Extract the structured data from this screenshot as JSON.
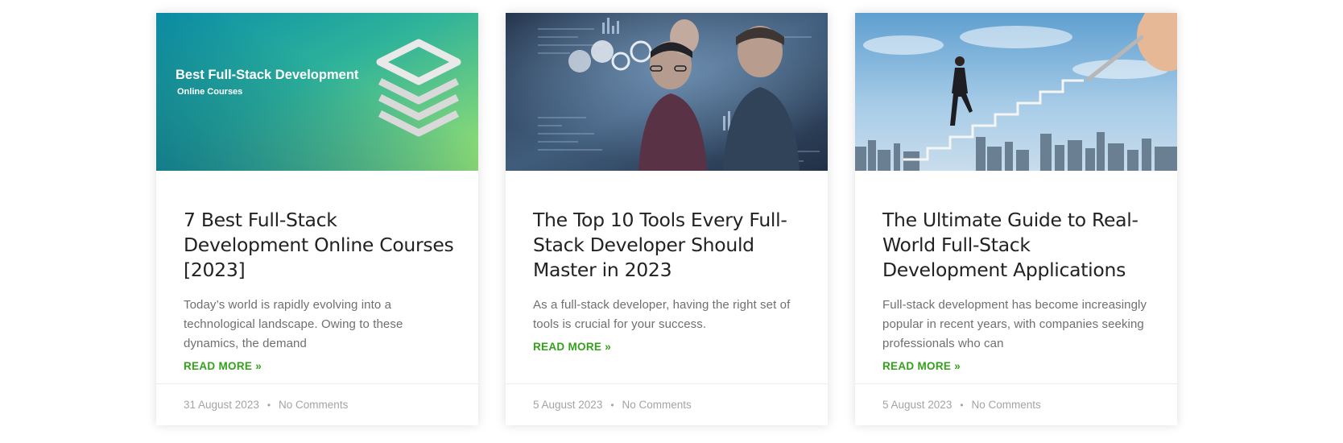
{
  "posts": [
    {
      "image_banner": {
        "heading": "Best Full-Stack Development",
        "subheading": "Online Courses"
      },
      "title": "7 Best Full-Stack Development Online Courses [2023]",
      "excerpt": "Today’s world is rapidly evolving into a technological landscape. Owing to these dynamics, the demand",
      "read_more": "READ MORE »",
      "date": "31 August 2023",
      "separator": "•",
      "comments": "No Comments"
    },
    {
      "title": "The Top 10 Tools Every Full-Stack Developer Should Master in 2023",
      "excerpt": "As a full-stack developer, having the right set of tools is crucial for your success.",
      "read_more": "READ MORE »",
      "date": "5 August 2023",
      "separator": "•",
      "comments": "No Comments"
    },
    {
      "title": "The Ultimate Guide to Real-World Full-Stack Development Applications",
      "excerpt": "Full-stack development has become increasingly popular in recent years, with companies seeking professionals who can",
      "read_more": "READ MORE »",
      "date": "5 August 2023",
      "separator": "•",
      "comments": "No Comments"
    }
  ],
  "colors": {
    "accent": "#33a11a",
    "title": "#222222",
    "excerpt": "#6f6f6f",
    "meta": "#a4a4a4"
  }
}
